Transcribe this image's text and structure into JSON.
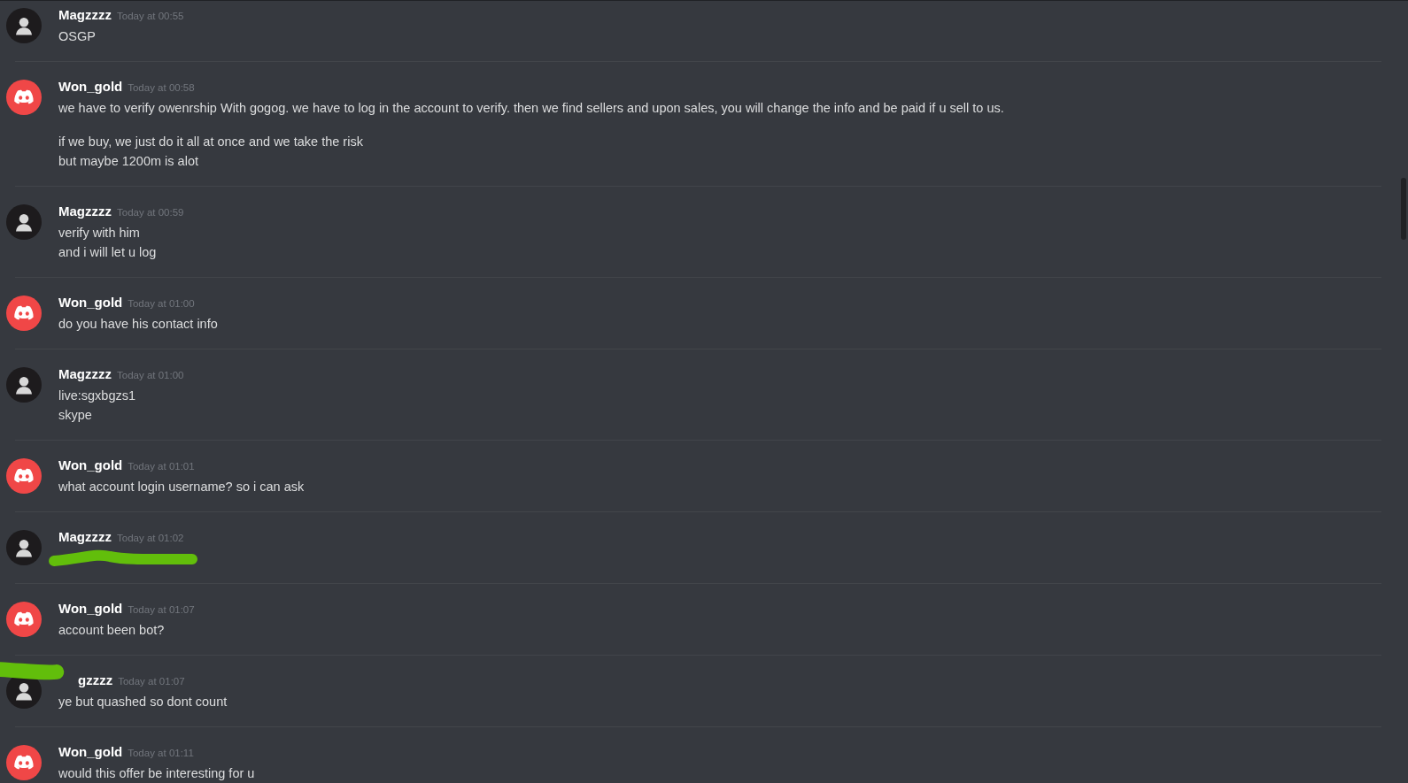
{
  "messages": [
    {
      "author": "Magzzzz",
      "kind": "silhouette",
      "time": "Today at 00:55",
      "paragraphs": [
        [
          "OSGP"
        ]
      ]
    },
    {
      "author": "Won_gold",
      "kind": "gamepad",
      "time": "Today at 00:58",
      "paragraphs": [
        [
          "we have to verify owenrship With gogog. we have to log in the account to verify. then we find sellers and upon sales, you will change the info and be paid if u sell to us."
        ],
        [
          "if we buy, we just do it all at once and we take the risk",
          "but maybe 1200m is alot"
        ]
      ]
    },
    {
      "author": "Magzzzz",
      "kind": "silhouette",
      "time": "Today at 00:59",
      "paragraphs": [
        [
          "verify with him",
          "and i will let u log"
        ]
      ]
    },
    {
      "author": "Won_gold",
      "kind": "gamepad",
      "time": "Today at 01:00",
      "paragraphs": [
        [
          "do you have his contact info"
        ]
      ]
    },
    {
      "author": "Magzzzz",
      "kind": "silhouette",
      "time": "Today at 01:00",
      "paragraphs": [
        [
          "live:sgxbgzs1",
          "skype"
        ]
      ]
    },
    {
      "author": "Won_gold",
      "kind": "gamepad",
      "time": "Today at 01:01",
      "paragraphs": [
        [
          "what account login username? so i can ask"
        ]
      ]
    },
    {
      "author": "Magzzzz",
      "kind": "silhouette",
      "time": "Today at 01:02",
      "text_redacted": true
    },
    {
      "author": "Won_gold",
      "kind": "gamepad",
      "time": "Today at 01:07",
      "paragraphs": [
        [
          "account been bot?"
        ]
      ]
    },
    {
      "author": "gzzzz",
      "kind": "silhouette",
      "time": "Today at 01:07",
      "name_redacted": true,
      "paragraphs": [
        [
          "ye but quashed so dont count"
        ]
      ]
    },
    {
      "author": "Won_gold",
      "kind": "gamepad",
      "time": "Today at 01:11",
      "paragraphs": [
        [
          "would this offer be interesting for u"
        ]
      ]
    }
  ]
}
